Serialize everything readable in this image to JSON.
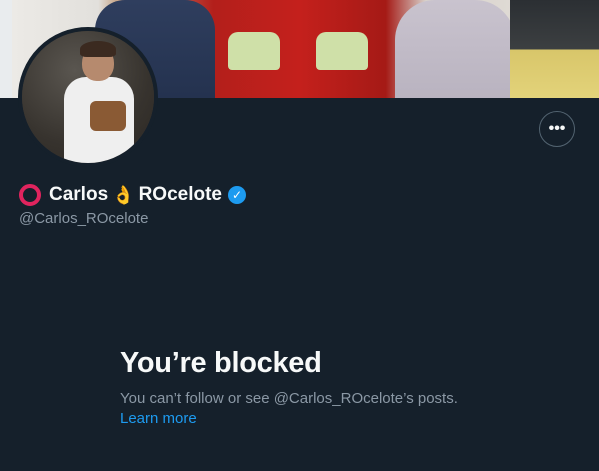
{
  "profile": {
    "display_name_first": "Carlos",
    "display_name_last": "ROcelote",
    "emoji_ring": "⭕",
    "emoji_ok": "👌",
    "handle": "@Carlos_ROcelote",
    "verified_icon": "verified-badge-icon",
    "more_icon": "more-options-icon",
    "more_glyph": "•••"
  },
  "blocked": {
    "title": "You’re blocked",
    "description": "You can’t follow or see @Carlos_ROcelote’s posts.",
    "learn_more": "Learn more"
  },
  "colors": {
    "background": "#15202b",
    "text_primary": "#f7f9f9",
    "text_secondary": "#8b98a5",
    "accent": "#1d9bf0",
    "ring": "#e0245e"
  }
}
